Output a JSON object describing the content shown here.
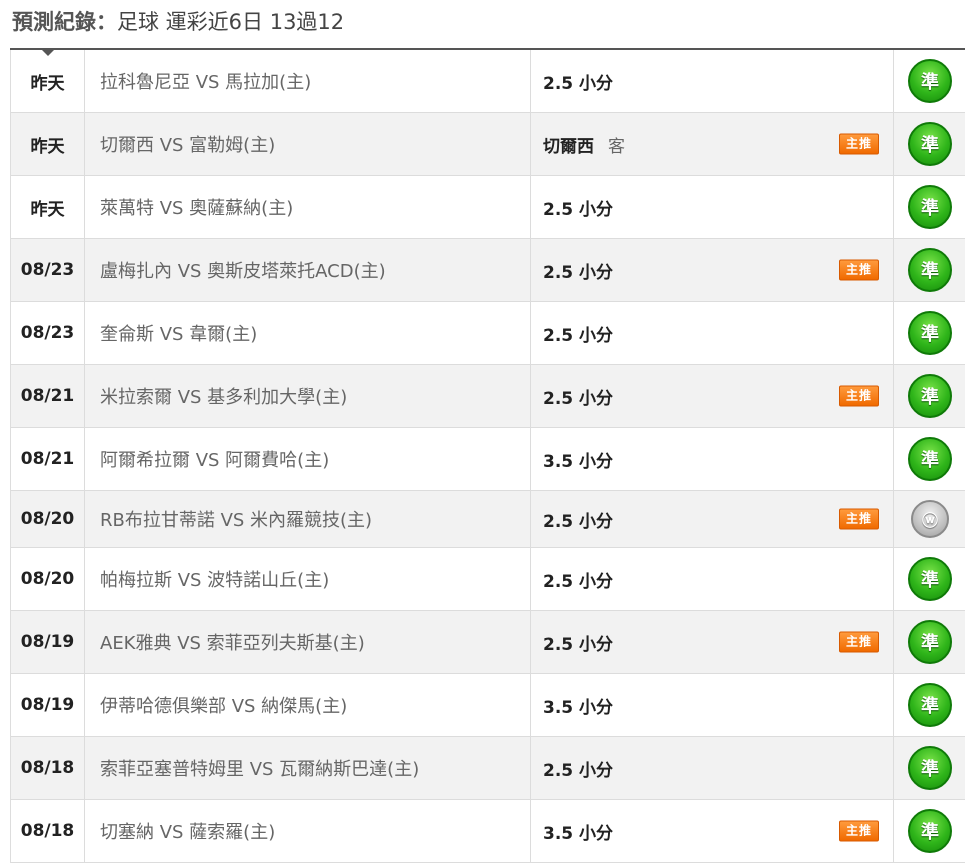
{
  "header": {
    "label": "預測紀錄",
    "sep": "：",
    "summary": "足球 運彩近6日 13過12"
  },
  "rows": [
    {
      "date": "昨天",
      "match": "拉科魯尼亞 VS 馬拉加(主)",
      "pick": "2.5 小分",
      "extra": "",
      "tag": "",
      "result": "準",
      "status": "win"
    },
    {
      "date": "昨天",
      "match": "切爾西 VS 富勒姆(主)",
      "pick": "切爾西",
      "extra": "客",
      "tag": "主推",
      "result": "準",
      "status": "win"
    },
    {
      "date": "昨天",
      "match": "萊萬特 VS 奧薩蘇納(主)",
      "pick": "2.5 小分",
      "extra": "",
      "tag": "",
      "result": "準",
      "status": "win"
    },
    {
      "date": "08/23",
      "match": "盧梅扎內 VS 奧斯皮塔萊托ACD(主)",
      "pick": "2.5 小分",
      "extra": "",
      "tag": "主推",
      "result": "準",
      "status": "win"
    },
    {
      "date": "08/23",
      "match": "奎侖斯 VS 韋爾(主)",
      "pick": "2.5 小分",
      "extra": "",
      "tag": "",
      "result": "準",
      "status": "win"
    },
    {
      "date": "08/21",
      "match": "米拉索爾 VS 基多利加大學(主)",
      "pick": "2.5 小分",
      "extra": "",
      "tag": "主推",
      "result": "準",
      "status": "win"
    },
    {
      "date": "08/21",
      "match": "阿爾希拉爾 VS 阿爾費哈(主)",
      "pick": "3.5 小分",
      "extra": "",
      "tag": "",
      "result": "準",
      "status": "win"
    },
    {
      "date": "08/20",
      "match": "RB布拉甘蒂諾 VS 米內羅競技(主)",
      "pick": "2.5 小分",
      "extra": "",
      "tag": "主推",
      "result": "ⓦ",
      "status": "push"
    },
    {
      "date": "08/20",
      "match": "帕梅拉斯 VS 波特諾山丘(主)",
      "pick": "2.5 小分",
      "extra": "",
      "tag": "",
      "result": "準",
      "status": "win"
    },
    {
      "date": "08/19",
      "match": "AEK雅典 VS 索菲亞列夫斯基(主)",
      "pick": "2.5 小分",
      "extra": "",
      "tag": "主推",
      "result": "準",
      "status": "win"
    },
    {
      "date": "08/19",
      "match": "伊蒂哈德俱樂部 VS 納傑馬(主)",
      "pick": "3.5 小分",
      "extra": "",
      "tag": "",
      "result": "準",
      "status": "win"
    },
    {
      "date": "08/18",
      "match": "索菲亞塞普特姆里 VS 瓦爾納斯巴達(主)",
      "pick": "2.5 小分",
      "extra": "",
      "tag": "",
      "result": "準",
      "status": "win"
    },
    {
      "date": "08/18",
      "match": "切塞納 VS 薩索羅(主)",
      "pick": "3.5 小分",
      "extra": "",
      "tag": "主推",
      "result": "準",
      "status": "win"
    }
  ],
  "colors": {
    "win": "#2fb51a",
    "push": "#bfbfbf",
    "tag": "#f06a00"
  }
}
